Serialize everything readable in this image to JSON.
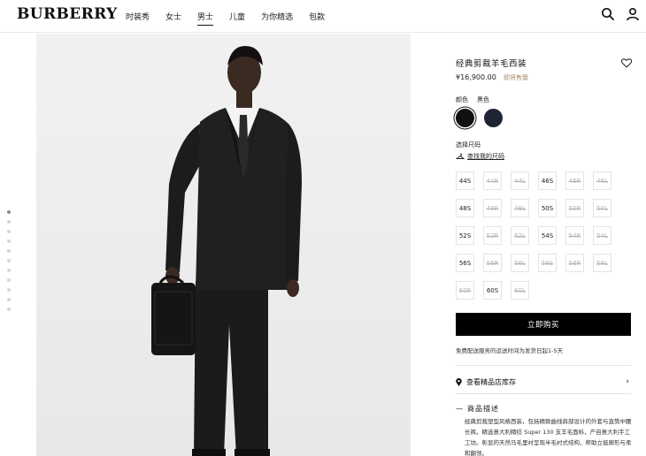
{
  "brand": {
    "logo": "BURBERRY"
  },
  "nav": {
    "items": [
      "时装秀",
      "女士",
      "男士",
      "儿童",
      "为你精选",
      "包款"
    ],
    "active_index": 2
  },
  "header_icons": {
    "search": "search-icon",
    "account": "user-icon"
  },
  "gallery": {
    "slide_count": 11,
    "active_index": 0
  },
  "product": {
    "title": "经典剪裁羊毛西装",
    "price": "¥16,900.00",
    "availability": "即将售罄",
    "favorite_icon": "heart-icon"
  },
  "colors": {
    "labels": [
      "颜色",
      "黑色"
    ],
    "swatches": [
      {
        "name": "black",
        "hex": "#111111",
        "selected": true
      },
      {
        "name": "navy",
        "hex": "#1e2434",
        "selected": false
      }
    ]
  },
  "size": {
    "title": "选择尺码",
    "guide": "查找我的尺码",
    "options": [
      {
        "label": "44S",
        "available": true
      },
      {
        "label": "44R",
        "available": false
      },
      {
        "label": "44L",
        "available": false
      },
      {
        "label": "46S",
        "available": true
      },
      {
        "label": "46R",
        "available": false
      },
      {
        "label": "46L",
        "available": false
      },
      {
        "label": "48S",
        "available": true
      },
      {
        "label": "48R",
        "available": false
      },
      {
        "label": "48L",
        "available": false
      },
      {
        "label": "50S",
        "available": true
      },
      {
        "label": "50R",
        "available": false
      },
      {
        "label": "50L",
        "available": false
      },
      {
        "label": "52S",
        "available": true
      },
      {
        "label": "52R",
        "available": false
      },
      {
        "label": "52L",
        "available": false
      },
      {
        "label": "54S",
        "available": true
      },
      {
        "label": "54R",
        "available": false
      },
      {
        "label": "54L",
        "available": false
      },
      {
        "label": "56S",
        "available": true
      },
      {
        "label": "56R",
        "available": false
      },
      {
        "label": "56L",
        "available": false
      },
      {
        "label": "58S",
        "available": false
      },
      {
        "label": "58R",
        "available": false
      },
      {
        "label": "58L",
        "available": false
      },
      {
        "label": "60R",
        "available": false
      },
      {
        "label": "60S",
        "available": true
      },
      {
        "label": "60L",
        "available": false
      }
    ]
  },
  "buy_button": "立即购买",
  "shipping_note": "免费配送服务的运送时间为发货日起1-5天",
  "store_stock": "查看精品店库存",
  "description": {
    "heading": "商品描述",
    "body": "经典剪裁塑型风格西装，包括精致曲线肩部设计的外套与直筒中腰长裤。精选意大利精纺 Super 130 支羊毛面料，产自意大利手工工坊。彰显的天然马毛里衬呈现半毛衬式结构，帮助立挺廓形与柔和翻领。"
  },
  "colors_ui": {
    "accent": "#000000",
    "availability": "#a58a6a",
    "photo_bg": "#eeeeee"
  }
}
